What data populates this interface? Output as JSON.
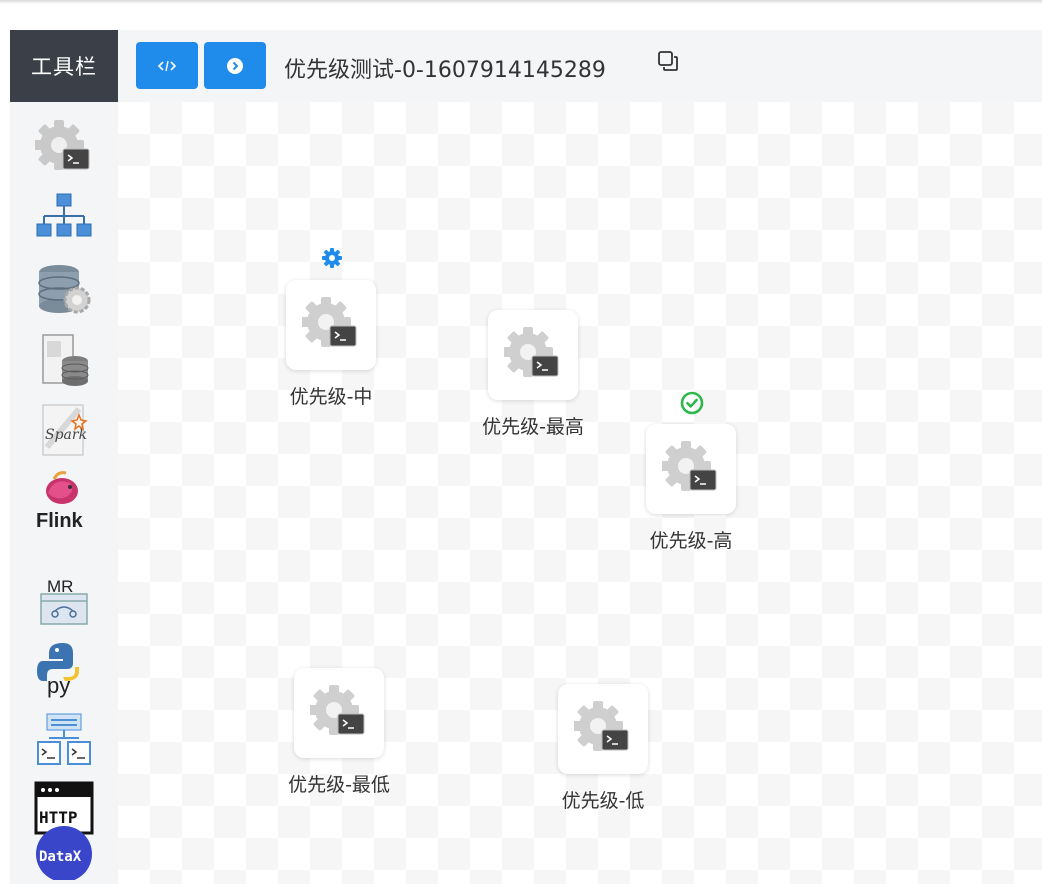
{
  "toolbar": {
    "title": "工具栏",
    "tools": [
      {
        "name": "shell-tool",
        "icon": "shell-gear-icon"
      },
      {
        "name": "sub-process-tool",
        "icon": "sub-process-icon"
      },
      {
        "name": "procedure-tool",
        "icon": "database-gear-icon"
      },
      {
        "name": "sql-tool",
        "icon": "sql-database-icon"
      },
      {
        "name": "spark-tool",
        "icon": "spark-icon",
        "text": "Spark"
      },
      {
        "name": "flink-tool",
        "icon": "flink-icon",
        "text": "Flink"
      },
      {
        "name": "mr-tool",
        "icon": "mapreduce-icon",
        "text": "MR"
      },
      {
        "name": "python-tool",
        "icon": "python-icon",
        "text": "py"
      },
      {
        "name": "dependent-tool",
        "icon": "dependent-icon"
      },
      {
        "name": "http-tool",
        "icon": "http-icon",
        "text": "HTTP"
      },
      {
        "name": "datax-tool",
        "icon": "datax-icon",
        "text": "DataX"
      }
    ]
  },
  "topbar": {
    "workflow_title": "优先级测试-0-1607914145289",
    "code_button_icon": "code-icon",
    "run_button_icon": "chevron-right-circle-icon",
    "copy_icon": "copy-icon"
  },
  "colors": {
    "primary": "#1f8ceb",
    "toolbar_header": "#3b4048",
    "success": "#2db84d",
    "running": "#1f8ceb"
  },
  "nodes": [
    {
      "id": "mid",
      "label": "优先级-中",
      "status": "running",
      "status_icon": "gear-icon"
    },
    {
      "id": "highest",
      "label": "优先级-最高",
      "status": "none"
    },
    {
      "id": "high",
      "label": "优先级-高",
      "status": "success",
      "status_icon": "check-circle-icon"
    },
    {
      "id": "lowest",
      "label": "优先级-最低",
      "status": "none"
    },
    {
      "id": "low",
      "label": "优先级-低",
      "status": "none"
    }
  ]
}
